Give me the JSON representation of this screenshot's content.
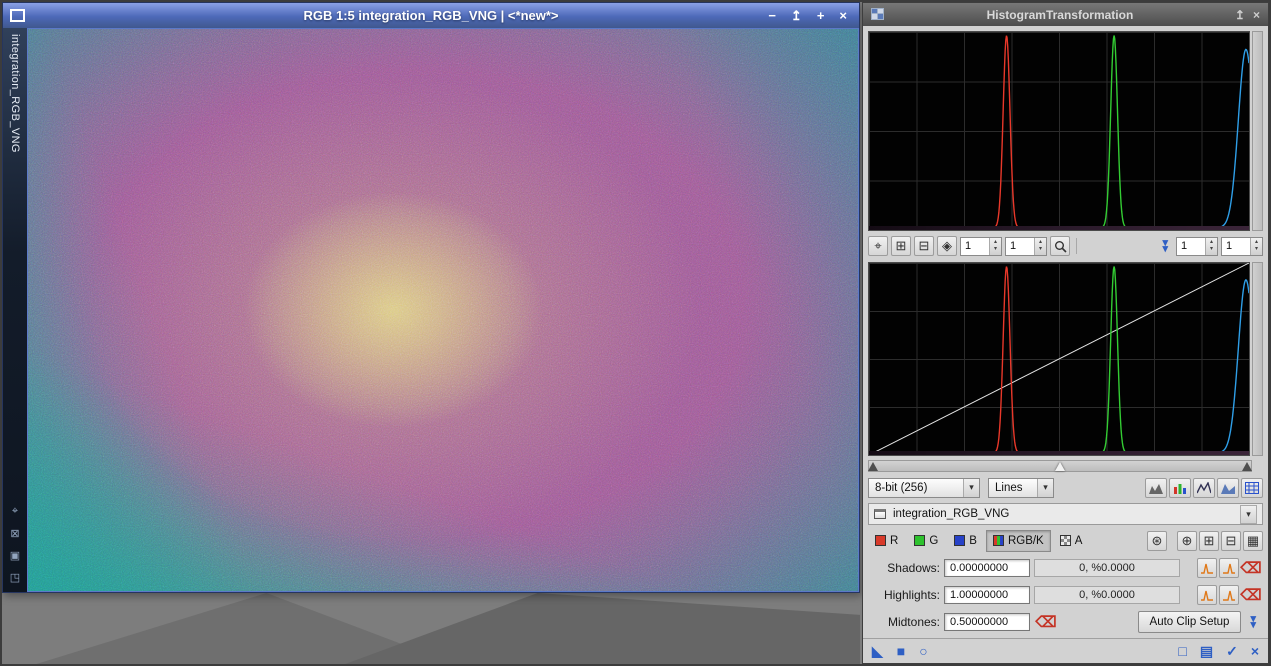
{
  "glyphs": {
    "dropdown": "▾",
    "spin_up": "▴",
    "spin_down": "▾",
    "minimize": "−",
    "shade": "↥",
    "zoom_window": "+",
    "close": "×",
    "track": "⌖",
    "expand": "⊞",
    "compress": "⊟",
    "readout_mode": "◈",
    "star": "⊛",
    "opt1": "⊕",
    "opt2": "⊞",
    "opt3": "⊟",
    "opt4": "▦",
    "clear": "⌫",
    "tri_bl": "◣",
    "square_filled": "■",
    "circle": "○",
    "square_outline": "□",
    "document": "▤",
    "check": "✓",
    "reset": "×",
    "side1": "⌖",
    "side2": "⊠",
    "side3": "▣",
    "side4": "◳"
  },
  "image_window": {
    "title": "RGB 1:5 integration_RGB_VNG | <*new*>",
    "side_tab_label": "integration_RGB_VNG"
  },
  "histogram_panel": {
    "title": "HistogramTransformation",
    "toolbar": {
      "horizontal_zoom": "1",
      "vertical_zoom": "1",
      "graph_horizontal_zoom": "1",
      "graph_vertical_zoom": "1"
    },
    "resolution_select": {
      "value": "8-bit (256)"
    },
    "graph_style_select": {
      "value": "Lines"
    },
    "view_selector": {
      "value": "integration_RGB_VNG"
    },
    "channels": {
      "r": "R",
      "g": "G",
      "b": "B",
      "rgbk": "RGB/K",
      "alpha": "A"
    },
    "parameters": {
      "shadows": {
        "label": "Shadows:",
        "value": "0.00000000",
        "readout": "0, %0.0000"
      },
      "highlights": {
        "label": "Highlights:",
        "value": "1.00000000",
        "readout": "0, %0.0000"
      },
      "midtones": {
        "label": "Midtones:",
        "value": "0.50000000"
      }
    },
    "auto_clip_button_label": "Auto Clip Setup"
  },
  "chart_data": [
    {
      "type": "histogram",
      "id": "input-histogram",
      "style": "lines",
      "background": "#000000",
      "grid": {
        "x_divisions": 8,
        "y_divisions": 4,
        "color": "#2c2c2c"
      },
      "x_range": [
        0,
        1
      ],
      "y_range": [
        0,
        1
      ],
      "series": [
        {
          "name": "R",
          "color": "#e8382a",
          "peak_x": 0.362,
          "sigma": 0.009,
          "peak_height": 0.97,
          "baseline": 0.012
        },
        {
          "name": "G",
          "color": "#33cc33",
          "peak_x": 0.645,
          "sigma": 0.009,
          "peak_height": 0.97,
          "baseline": 0.012
        },
        {
          "name": "B",
          "color": "#2f9fe8",
          "peak_x": 0.992,
          "sigma": 0.02,
          "peak_height": 0.9,
          "baseline": 0.012
        }
      ]
    },
    {
      "type": "histogram",
      "id": "transfer-histogram",
      "style": "lines",
      "background": "#000000",
      "grid": {
        "x_divisions": 8,
        "y_divisions": 4,
        "color": "#2c2c2c"
      },
      "x_range": [
        0,
        1
      ],
      "y_range": [
        0,
        1
      ],
      "transfer_line": {
        "x0": 0,
        "y0": 0,
        "x1": 1,
        "y1": 1,
        "color": "#e4e4e4"
      },
      "series": [
        {
          "name": "R",
          "color": "#e8382a",
          "peak_x": 0.362,
          "sigma": 0.009,
          "peak_height": 0.97,
          "baseline": 0.012
        },
        {
          "name": "G",
          "color": "#33cc33",
          "peak_x": 0.645,
          "sigma": 0.009,
          "peak_height": 0.97,
          "baseline": 0.012
        },
        {
          "name": "B",
          "color": "#2f9fe8",
          "peak_x": 0.992,
          "sigma": 0.02,
          "peak_height": 0.9,
          "baseline": 0.012
        }
      ]
    }
  ]
}
